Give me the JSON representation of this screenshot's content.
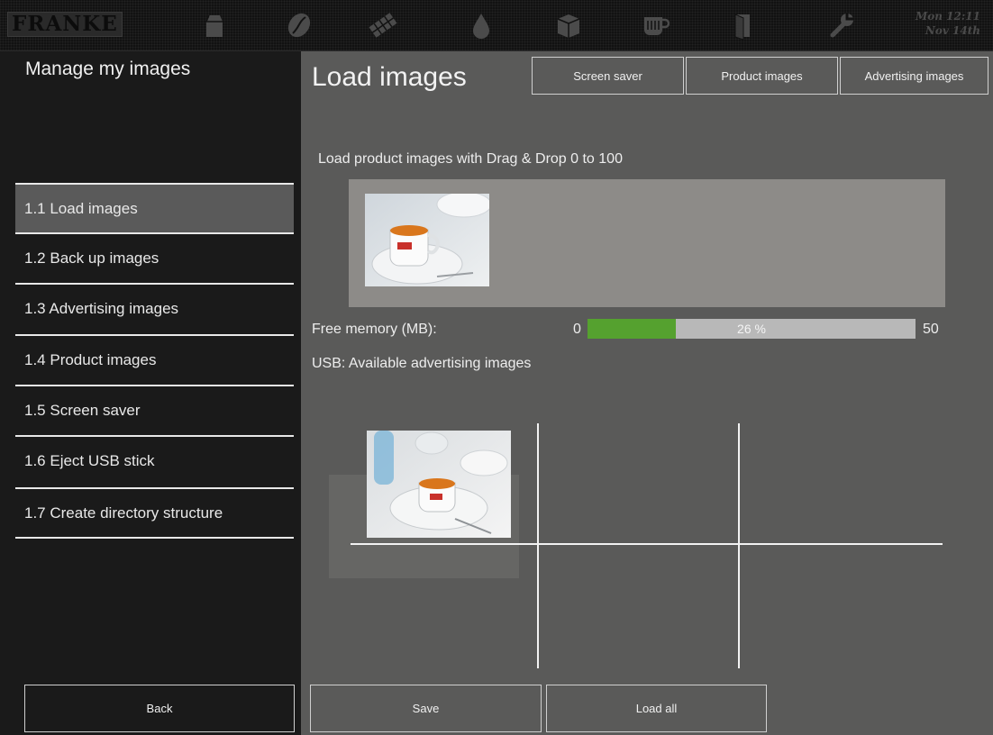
{
  "topbar": {
    "logo": "FRANKE",
    "icons": [
      "milk-carton-icon",
      "coffee-bean-icon",
      "chocolate-icon",
      "water-drop-icon",
      "box-icon",
      "cup-icon",
      "door-icon",
      "wrench-icon"
    ],
    "datetime_line1": "Mon 12:11",
    "datetime_line2": "Nov 14th"
  },
  "sidebar": {
    "title": "Manage my images",
    "items": [
      {
        "label": "1.1 Load images",
        "active": true
      },
      {
        "label": "1.2 Back up images"
      },
      {
        "label": "1.3 Advertising images"
      },
      {
        "label": "1.4 Product images"
      },
      {
        "label": "1.5 Screen saver"
      },
      {
        "label": "1.6 Eject USB stick"
      },
      {
        "label": "1.7  Create directory structure"
      }
    ],
    "back_label": "Back"
  },
  "main": {
    "title": "Load images",
    "tabs": [
      "Screen saver",
      "Product images",
      "Advertising images"
    ],
    "dropzone_label": "Load product images with Drag & Drop 0 to 100",
    "memory": {
      "label": "Free memory (MB):",
      "min": "0",
      "max": "50",
      "percent_text": "26 %",
      "fill_fraction": 0.27
    },
    "usb_label": "USB: Available advertising images",
    "buttons": {
      "save": "Save",
      "load_all": "Load all"
    }
  },
  "colors": {
    "sidebar_bg": "#1a1a1a",
    "main_bg": "#5a5a59",
    "dropzone_bg": "#8d8b88",
    "progress_fill": "#55a12f",
    "progress_track": "#b8b8b8",
    "active_item": "#5a5a5a"
  }
}
